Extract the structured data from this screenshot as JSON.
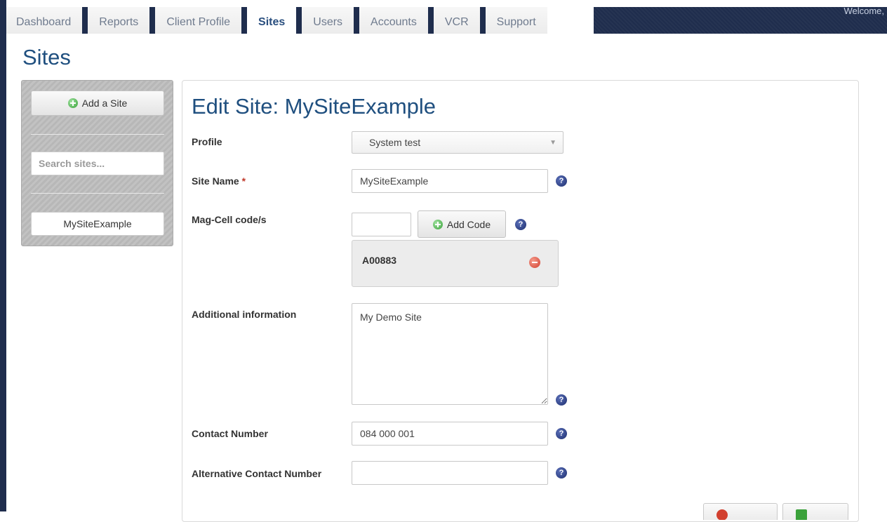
{
  "nav": {
    "tabs": [
      {
        "label": "Dashboard"
      },
      {
        "label": "Reports"
      },
      {
        "label": "Client Profile"
      },
      {
        "label": "Sites",
        "active": true
      },
      {
        "label": "Users"
      },
      {
        "label": "Accounts"
      },
      {
        "label": "VCR"
      },
      {
        "label": "Support"
      }
    ],
    "welcome": "Welcome,"
  },
  "page": {
    "title": "Sites"
  },
  "sidebar": {
    "add_button": "Add a Site",
    "search_placeholder": "Search sites...",
    "sites": [
      "MySiteExample"
    ]
  },
  "form": {
    "title": "Edit Site: MySiteExample",
    "profile": {
      "label": "Profile",
      "value": "System test"
    },
    "site_name": {
      "label": "Site Name",
      "required_mark": "*",
      "value": "MySiteExample"
    },
    "mag_cell": {
      "label": "Mag-Cell code/s",
      "input_value": "",
      "add_button": "Add Code",
      "codes": [
        "A00883"
      ]
    },
    "additional_info": {
      "label": "Additional information",
      "value": "My Demo Site"
    },
    "contact_number": {
      "label": "Contact Number",
      "value": "084 000 001"
    },
    "alt_contact_number": {
      "label": "Alternative Contact Number",
      "value": ""
    },
    "help_glyph": "?"
  },
  "colors": {
    "nav_dark": "#1f2d4d",
    "title_blue": "#1f4f7f",
    "required_red": "#c0392b",
    "help_blue": "#2b3f8a"
  }
}
